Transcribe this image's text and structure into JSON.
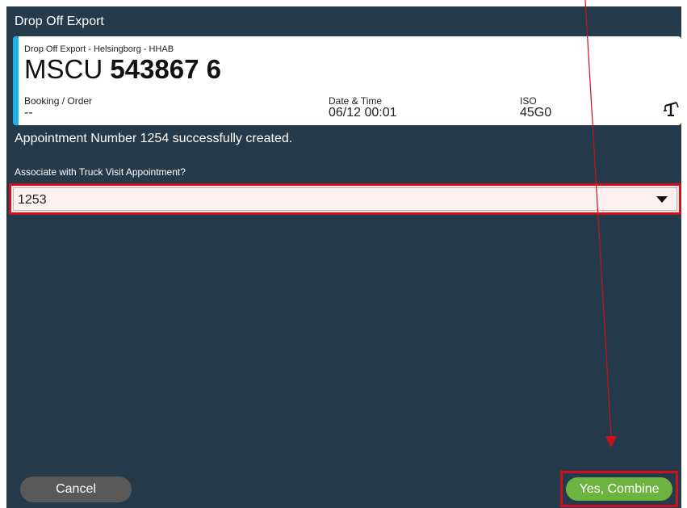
{
  "dialog": {
    "title": "Drop Off Export"
  },
  "card": {
    "subtitle": "Drop Off Export - Helsingborg - HHAB",
    "container_prefix": "MSCU",
    "container_number": "543867 6",
    "booking_label": "Booking / Order",
    "booking_value": "--",
    "datetime_label": "Date & Time",
    "datetime_value": "06/12 00:01",
    "iso_label": "ISO",
    "iso_value": "45G0",
    "accent_color": "#20b0e8",
    "icon": "crane-truck-icon"
  },
  "message": {
    "success": "Appointment Number 1254 successfully created."
  },
  "association": {
    "label": "Associate with Truck Visit Appointment?",
    "selected_value": "1253"
  },
  "buttons": {
    "cancel_label": "Cancel",
    "combine_label": "Yes, Combine"
  },
  "colors": {
    "background": "#253a4b",
    "highlight": "#d0101c",
    "combine": "#6cb43f",
    "cancel": "#595959"
  }
}
